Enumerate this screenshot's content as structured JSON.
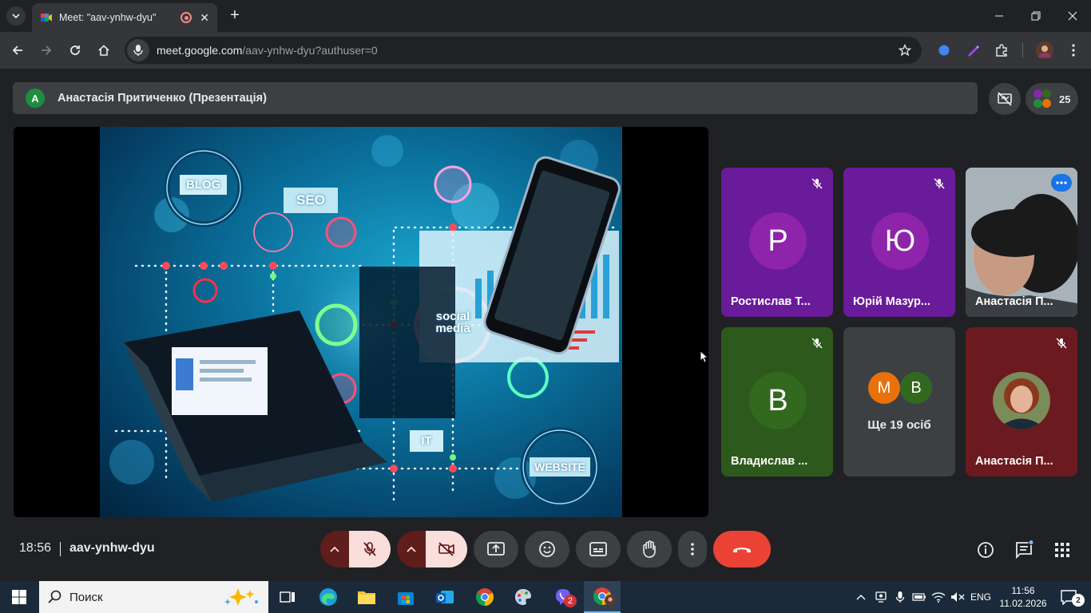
{
  "browser": {
    "tab_title": "Meet: \"aav-ynhw-dyu\"",
    "url_host": "meet.google.com",
    "url_path": "/aav-ynhw-dyu?authuser=0"
  },
  "meet": {
    "presenter": {
      "initial": "A",
      "name": "Анастасія Притиченко (Презентація)"
    },
    "participants_count": "25",
    "slide_labels": [
      "BLOG",
      "SEO",
      "social media",
      "IT",
      "WEBSITE"
    ],
    "tiles": [
      {
        "initial": "Р",
        "name": "Ростислав Т...",
        "bg": "#7b1fa2",
        "avatar_bg": "#8e24aa",
        "muted": true
      },
      {
        "initial": "Ю",
        "name": "Юрій Мазур...",
        "bg": "#7b1fa2",
        "avatar_bg": "#8e24aa",
        "muted": true
      },
      {
        "initial": "",
        "name": "Анастасія П...",
        "bg": "#9aa5ac",
        "muted": false,
        "active": true
      },
      {
        "initial": "В",
        "name": "Владислав ...",
        "bg": "#2e5d1f",
        "avatar_bg": "#33691e",
        "muted": true
      },
      {
        "initial": "",
        "name": "Ще 19 осіб",
        "bg": "#3c4043",
        "more": [
          "M",
          "B"
        ]
      },
      {
        "initial": "",
        "name": "Анастасія П...",
        "bg": "#6b1a1f",
        "muted": true
      }
    ],
    "time": "18:56",
    "meeting_code": "aav-ynhw-dyu"
  },
  "taskbar": {
    "search_placeholder": "Поиск",
    "lang": "ENG",
    "clock_time": "11:56",
    "clock_date": "11.02.2026",
    "notif_count": "2",
    "viber_badge": "2"
  },
  "colors": {
    "meet_bg": "#202124",
    "end_call": "#ea4335",
    "mic_off_bg": "#f9dedc",
    "accent_blue": "#8ab4f8"
  }
}
